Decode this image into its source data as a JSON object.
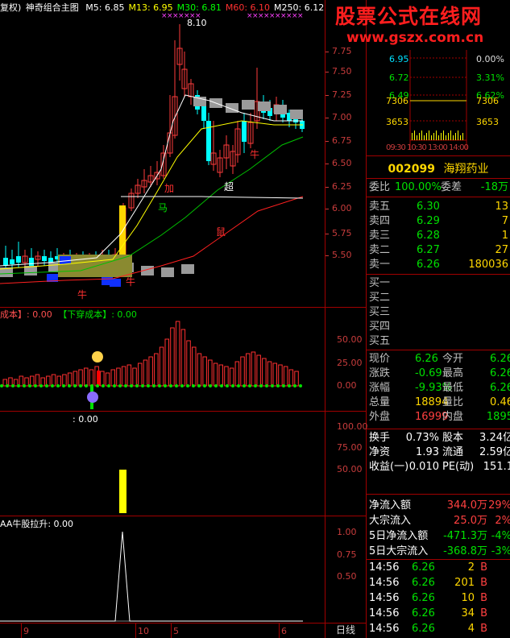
{
  "header": {
    "left_fragment": "复权)",
    "indicator": "神奇组合主图",
    "ma": [
      {
        "label": "M5: 6.85",
        "color": "#ffffff"
      },
      {
        "label": "M13: 6.95",
        "color": "#ffff00"
      },
      {
        "label": "M30: 6.81",
        "color": "#00ff00"
      },
      {
        "label": "M60: 6.10",
        "color": "#ff3030"
      },
      {
        "label": "M250: 6.12",
        "color": "#ffffff"
      }
    ]
  },
  "watermark": {
    "line1": "股票公式在线网",
    "line2": "www.gszx.com.cn"
  },
  "main_chart": {
    "high_label": "8.10",
    "price_ticks": [
      "7.75",
      "7.50",
      "7.25",
      "7.00",
      "6.75",
      "6.50",
      "6.25",
      "6.00",
      "5.75",
      "5.50"
    ],
    "annotations": [
      "牛",
      "加",
      "马",
      "超",
      "牛",
      "鼠",
      "牛"
    ]
  },
  "panel2": {
    "title_left": "成本】: 0.00",
    "title_right": "【下穿成本】: 0.00",
    "ticks": [
      "50.00",
      "25.00",
      "0.00"
    ]
  },
  "panel3": {
    "title": ": 0.00",
    "ticks": [
      "100.00",
      "75.00",
      "50.00"
    ]
  },
  "panel4": {
    "title": "AA牛股拉升: 0.00",
    "ticks": [
      "1.00",
      "0.75",
      "0.50"
    ]
  },
  "bottom_axis": {
    "labels": [
      "9",
      "10",
      "5",
      "6"
    ],
    "period": "日线"
  },
  "mini_chart": {
    "left_prices": [
      "6.95",
      "6.72",
      "6.49"
    ],
    "right_pct": [
      "0.00%",
      "3.31%",
      "6.62%"
    ],
    "vol_left": [
      "7306",
      "3653"
    ],
    "vol_right": [
      "7306",
      "3653"
    ],
    "time_labels": "09:30 10:30 13:00 14:00"
  },
  "stock": {
    "code": "002099",
    "name": "海翔药业"
  },
  "order_book": {
    "weibi_label": "委比",
    "weibi_value": "100.00%",
    "weicha_label": "委差",
    "weicha_value": "-18万",
    "sells": [
      {
        "label": "卖五",
        "price": "6.30",
        "vol": "13"
      },
      {
        "label": "卖四",
        "price": "6.29",
        "vol": "7"
      },
      {
        "label": "卖三",
        "price": "6.28",
        "vol": "1"
      },
      {
        "label": "卖二",
        "price": "6.27",
        "vol": "27"
      },
      {
        "label": "卖一",
        "price": "6.26",
        "vol": "180036"
      }
    ],
    "buys": [
      "买一",
      "买二",
      "买三",
      "买四",
      "买五"
    ]
  },
  "quote": [
    {
      "l1": "现价",
      "v1": "6.26",
      "c1": "green",
      "l2": "今开",
      "v2": "6.26",
      "c2": "green"
    },
    {
      "l1": "涨跌",
      "v1": "-0.69",
      "c1": "green",
      "l2": "最高",
      "v2": "6.26",
      "c2": "green"
    },
    {
      "l1": "涨幅",
      "v1": "-9.93%",
      "c1": "green",
      "l2": "最低",
      "v2": "6.26",
      "c2": "green"
    },
    {
      "l1": "总量",
      "v1": "18894",
      "c1": "yellow",
      "l2": "量比",
      "v2": "0.46",
      "c2": "yellow"
    },
    {
      "l1": "外盘",
      "v1": "16999",
      "c1": "red",
      "l2": "内盘",
      "v2": "1895",
      "c2": "green"
    }
  ],
  "fundamentals": [
    {
      "l1": "换手",
      "v1": "0.73%",
      "l2": "股本",
      "v2": "3.24亿"
    },
    {
      "l1": "净资",
      "v1": "1.93",
      "l2": "流通",
      "v2": "2.59亿"
    },
    {
      "l1": "收益(一)",
      "v1": "0.010",
      "l2": "PE(动)",
      "v2": "151.1"
    }
  ],
  "flow": [
    {
      "label": "净流入额",
      "value": "344.0万",
      "pct": "29%",
      "color": "red"
    },
    {
      "label": "大宗流入",
      "value": "25.0万",
      "pct": "2%",
      "color": "red"
    },
    {
      "label": "5日净流入额",
      "value": "-471.3万",
      "pct": "-4%",
      "color": "green"
    },
    {
      "label": "5日大宗流入",
      "value": "-368.8万",
      "pct": "-3%",
      "color": "green"
    }
  ],
  "trades": [
    {
      "time": "14:56",
      "price": "6.26",
      "vol": "2",
      "side": "B"
    },
    {
      "time": "14:56",
      "price": "6.26",
      "vol": "201",
      "side": "B"
    },
    {
      "time": "14:56",
      "price": "6.26",
      "vol": "10",
      "side": "B"
    },
    {
      "time": "14:56",
      "price": "6.26",
      "vol": "34",
      "side": "B"
    },
    {
      "time": "14:56",
      "price": "6.26",
      "vol": "4",
      "side": "B"
    }
  ]
}
